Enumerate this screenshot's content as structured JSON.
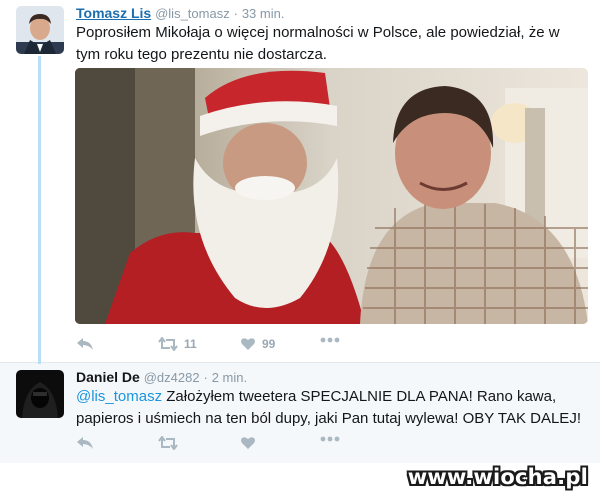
{
  "tweets": [
    {
      "name": "Tomasz Lis",
      "handle": "@lis_tomasz",
      "separator": "·",
      "time": "33 min.",
      "text": "Poprosiłem Mikołaja o więcej normalności w Polsce, ale powiedział, że w tym roku tego prezentu nie dostarcza.",
      "retweets": "11",
      "likes": "99"
    },
    {
      "name": "Daniel De",
      "handle": "@dz4282",
      "separator": "·",
      "time": "2 min.",
      "mention": "@lis_tomasz",
      "text": " Założyłem tweetera SPECJALNIE DLA PANA! Rano kawa, papieros i uśmiech na ten ból dupy, jaki Pan tutaj wylewa! OBY TAK DALEJ!"
    }
  ],
  "icons": {
    "reply": "reply-icon",
    "retweet": "retweet-icon",
    "like": "heart-icon",
    "more": "more-icon"
  },
  "colors": {
    "name_link": "#1b6fb0",
    "mention": "#1b95e0",
    "thread_line": "#b8dff5"
  },
  "watermark": "www.wiocha.pl"
}
